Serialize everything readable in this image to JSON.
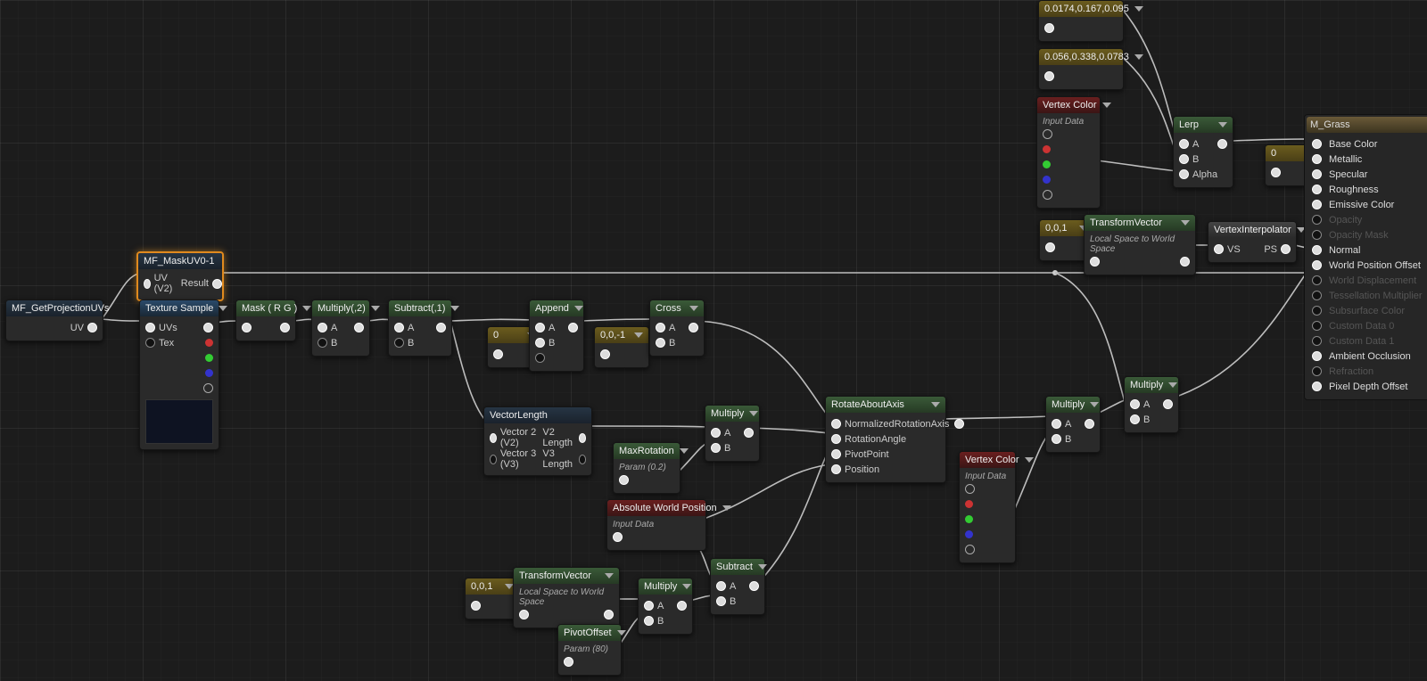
{
  "nodes": {
    "getproj": {
      "title": "MF_GetProjectionUVs",
      "out": "UV"
    },
    "maskuv": {
      "title": "MF_MaskUV0-1",
      "in": "UV (V2)",
      "out": "Result"
    },
    "texsample": {
      "title": "Texture Sample",
      "in1": "UVs",
      "in2": "Tex"
    },
    "maskrg": {
      "title": "Mask ( R G )"
    },
    "mult2": {
      "title": "Multiply(,2)",
      "a": "A",
      "b": "B"
    },
    "sub1": {
      "title": "Subtract(,1)",
      "a": "A",
      "b": "B"
    },
    "append": {
      "title": "Append",
      "a": "A",
      "b": "B"
    },
    "cross": {
      "title": "Cross",
      "a": "A",
      "b": "B"
    },
    "const0": {
      "title": "0"
    },
    "c001": {
      "title": "0,0,-1"
    },
    "veclen": {
      "title": "VectorLength",
      "r1l": "Vector 2 (V2)",
      "r1r": "V2 Length",
      "r2l": "Vector 3 (V3)",
      "r2r": "V3 Length"
    },
    "maxrot": {
      "title": "MaxRotation",
      "sub": "Param (0.2)"
    },
    "multA": {
      "title": "Multiply",
      "a": "A",
      "b": "B"
    },
    "absworld": {
      "title": "Absolute World Position",
      "sub": "Input Data"
    },
    "c001b": {
      "title": "0,0,1"
    },
    "transv1": {
      "title": "TransformVector",
      "sub": "Local Space to World Space"
    },
    "multB": {
      "title": "Multiply",
      "a": "A",
      "b": "B"
    },
    "pivotoff": {
      "title": "PivotOffset",
      "sub": "Param (80)"
    },
    "subC": {
      "title": "Subtract",
      "a": "A",
      "b": "B"
    },
    "rotaxis": {
      "title": "RotateAboutAxis",
      "p1": "NormalizedRotationAxis",
      "p2": "RotationAngle",
      "p3": "PivotPoint",
      "p4": "Position"
    },
    "vcol1": {
      "title": "Vertex Color",
      "sub": "Input Data"
    },
    "vcol2": {
      "title": "Vertex Color",
      "sub": "Input Data"
    },
    "multC": {
      "title": "Multiply",
      "a": "A",
      "b": "B"
    },
    "multD": {
      "title": "Multiply",
      "a": "A",
      "b": "B"
    },
    "colA": {
      "title": "0.0174,0.167,0.095"
    },
    "colB": {
      "title": "0.056,0.338,0.0783"
    },
    "lerp": {
      "title": "Lerp",
      "a": "A",
      "b": "B",
      "c": "Alpha"
    },
    "c0": {
      "title": "0"
    },
    "c001c": {
      "title": "0,0,1"
    },
    "transv2": {
      "title": "TransformVector",
      "sub": "Local Space to World Space"
    },
    "vinterp": {
      "title": "VertexInterpolator",
      "l": "VS",
      "r": "PS"
    }
  },
  "result": {
    "title": "M_Grass",
    "pins": [
      {
        "label": "Base Color",
        "enabled": true
      },
      {
        "label": "Metallic",
        "enabled": true
      },
      {
        "label": "Specular",
        "enabled": true
      },
      {
        "label": "Roughness",
        "enabled": true
      },
      {
        "label": "Emissive Color",
        "enabled": true
      },
      {
        "label": "Opacity",
        "enabled": false
      },
      {
        "label": "Opacity Mask",
        "enabled": false
      },
      {
        "label": "Normal",
        "enabled": true
      },
      {
        "label": "World Position Offset",
        "enabled": true
      },
      {
        "label": "World Displacement",
        "enabled": false
      },
      {
        "label": "Tessellation Multiplier",
        "enabled": false
      },
      {
        "label": "Subsurface Color",
        "enabled": false
      },
      {
        "label": "Custom Data 0",
        "enabled": false
      },
      {
        "label": "Custom Data 1",
        "enabled": false
      },
      {
        "label": "Ambient Occlusion",
        "enabled": true
      },
      {
        "label": "Refraction",
        "enabled": false
      },
      {
        "label": "Pixel Depth Offset",
        "enabled": true
      }
    ]
  }
}
